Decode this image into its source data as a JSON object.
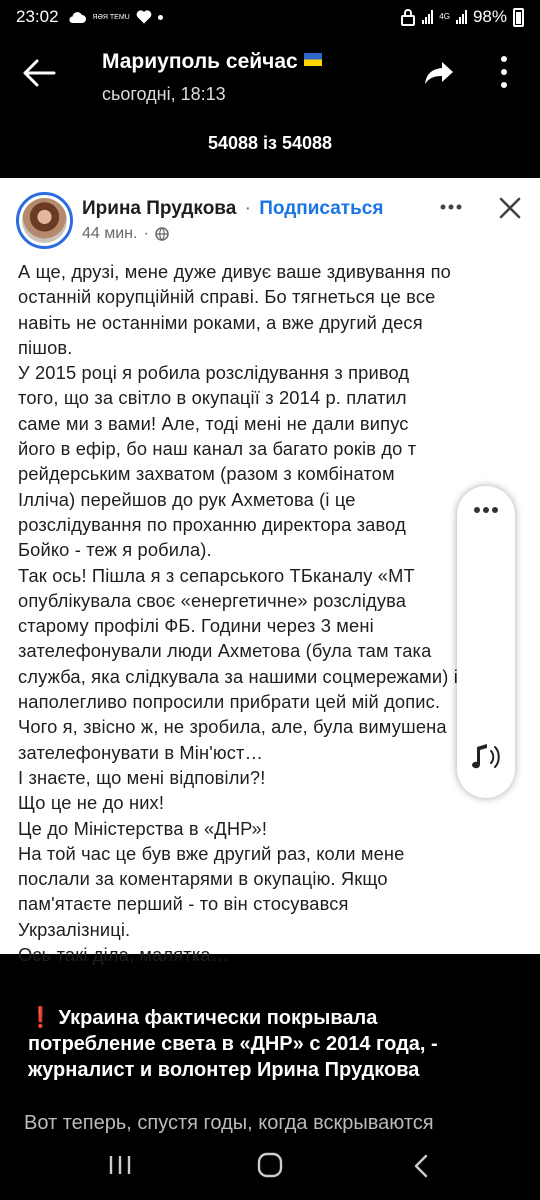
{
  "status_bar": {
    "time": "23:02",
    "battery": "98%",
    "temu_badge": "ЯӘЯ TEMU",
    "network": "4G",
    "icons": [
      "cloud-icon",
      "heart-icon",
      "lock-icon",
      "signal-icon",
      "battery-icon"
    ]
  },
  "header": {
    "title": "Мариуполь сейчас",
    "subtitle": "сьогодні, 18:13",
    "counter": "54088 із 54088",
    "icons": [
      "back-arrow-icon",
      "share-icon",
      "more-vertical-icon"
    ]
  },
  "post": {
    "author": "Ирина Прудкова",
    "separator": "·",
    "follow_label": "Подписаться",
    "time": "44 мин.",
    "time_separator": "·",
    "icons": [
      "more-horizontal-icon",
      "close-icon",
      "globe-icon"
    ],
    "lines": [
      "А ще, друзі, мене дуже дивує ваше здивування по",
      "останній корупційній справі. Бо тягнеться це все",
      "навіть не останніми роками, а вже другий деся",
      "пішов.",
      "У 2015 році я робила розслідування з привод",
      "того, що за світло в окупації  з 2014 р. платил",
      "саме ми з вами! Але, тоді мені не дали випус",
      "його в ефір, бо наш канал за багато років до т",
      "рейдерським захватом (разом з комбінатом",
      "Ілліча) перейшов до рук Ахметова (і це",
      "розслідування по проханню директора завод",
      "Бойко - теж я робила).",
      "Так ось! Пішла я з сепарського ТБканалу «МТ",
      "опублікувала своє «енергетичне» розслідува",
      "старому профілі ФБ. Години через 3 мені",
      "зателефонували люди Ахметова (була там така",
      "служба, яка слідкувала за нашими соцмережами) і",
      "наполегливо попросили прибрати цей мій допис.",
      "Чого я, звісно ж, не зробила, але, була вимушена",
      "зателефонувати в Мін'юст…",
      "І знаєте, що мені відповіли?!",
      "Що це не до них!",
      "Це до Міністерства в «ДНР»!",
      "На той час це був вже другий раз, коли мене",
      "послали за коментарями в окупацію. Якщо",
      "пам'ятаєте перший - то він стосувався",
      "Укрзалізниці.",
      "Ось такі діла, малятка…"
    ]
  },
  "overlay": {
    "icons": [
      "more-horizontal-icon",
      "audio-note-icon"
    ]
  },
  "message": {
    "emoji": "❗",
    "lines": [
      "Украина фактически покрывала",
      "потребление света в «ДНР» с 2014 года, -",
      "журналист и волонтер Ирина Прудкова"
    ],
    "teaser": "Вот теперь, спустя годы, когда вскрываются"
  },
  "navbar": {
    "icons": [
      "recent-apps-icon",
      "home-icon",
      "back-icon"
    ]
  }
}
